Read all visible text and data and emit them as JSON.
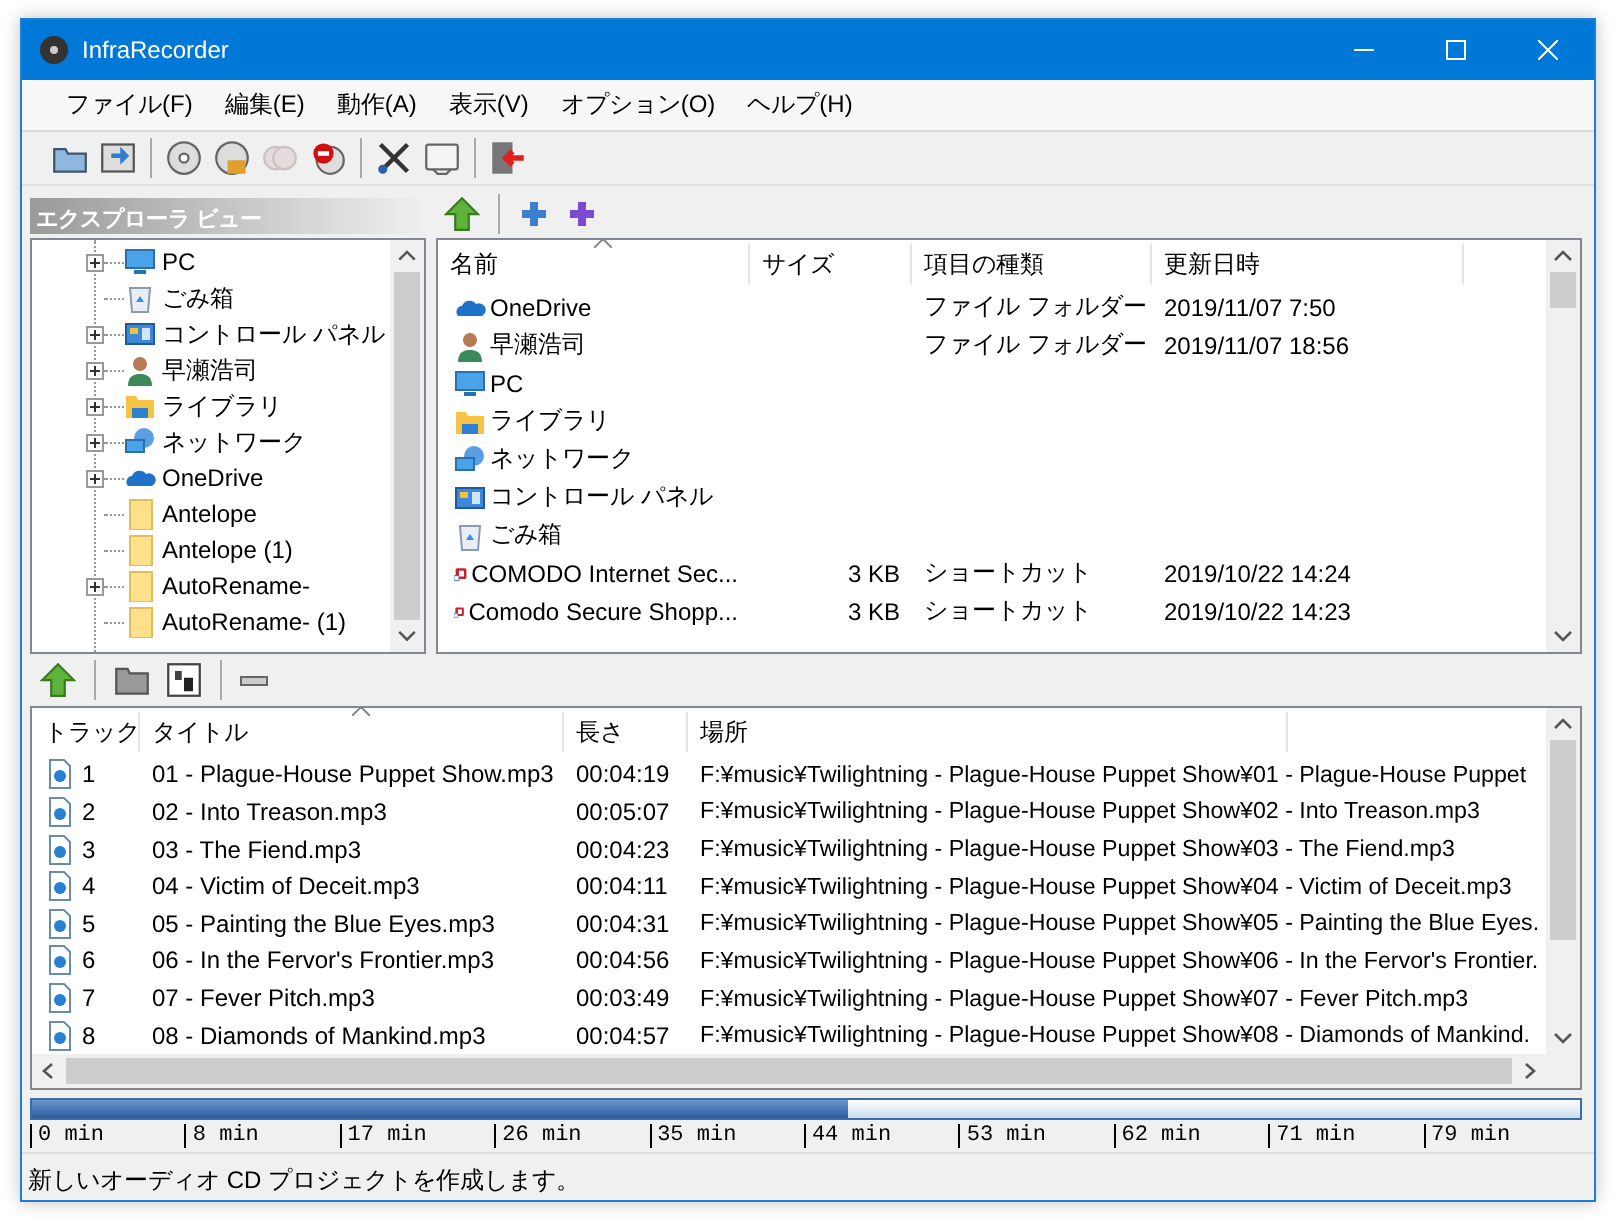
{
  "window": {
    "title": "InfraRecorder"
  },
  "menu": [
    "ファイル(F)",
    "編集(E)",
    "動作(A)",
    "表示(V)",
    "オプション(O)",
    "ヘルプ(H)"
  ],
  "toolbar": [
    {
      "kind": "open",
      "disabled": false
    },
    {
      "kind": "save",
      "disabled": false
    },
    {
      "kind": "sep"
    },
    {
      "kind": "disc",
      "disabled": false
    },
    {
      "kind": "discbox",
      "disabled": false
    },
    {
      "kind": "discs",
      "disabled": true
    },
    {
      "kind": "discstop",
      "disabled": false
    },
    {
      "kind": "sep"
    },
    {
      "kind": "scissors",
      "disabled": false
    },
    {
      "kind": "tray",
      "disabled": false
    },
    {
      "kind": "sep"
    },
    {
      "kind": "exit",
      "disabled": false
    }
  ],
  "explorer": {
    "title": "エクスプローラ ビュー",
    "tree": [
      {
        "label": "PC",
        "kind": "pc",
        "expandable": true
      },
      {
        "label": "ごみ箱",
        "kind": "recycle",
        "expandable": false
      },
      {
        "label": "コントロール パネル",
        "kind": "control",
        "expandable": true
      },
      {
        "label": "早瀬浩司",
        "kind": "user",
        "expandable": true
      },
      {
        "label": "ライブラリ",
        "kind": "library",
        "expandable": true
      },
      {
        "label": "ネットワーク",
        "kind": "network",
        "expandable": true
      },
      {
        "label": "OneDrive",
        "kind": "onedrive",
        "expandable": true
      },
      {
        "label": "Antelope",
        "kind": "folder",
        "expandable": false
      },
      {
        "label": "Antelope (1)",
        "kind": "folder",
        "expandable": false
      },
      {
        "label": "AutoRename-",
        "kind": "folder",
        "expandable": true
      },
      {
        "label": "AutoRename- (1)",
        "kind": "folder",
        "expandable": false
      }
    ],
    "files": {
      "columns": [
        "名前",
        "サイズ",
        "項目の種類",
        "更新日時"
      ],
      "rows": [
        {
          "name": "OneDrive",
          "kind": "onedrive",
          "size": "",
          "type": "ファイル フォルダー",
          "date": "2019/11/07 7:50"
        },
        {
          "name": "早瀬浩司",
          "kind": "user",
          "size": "",
          "type": "ファイル フォルダー",
          "date": "2019/11/07 18:56"
        },
        {
          "name": "PC",
          "kind": "pc",
          "size": "",
          "type": "",
          "date": ""
        },
        {
          "name": "ライブラリ",
          "kind": "library",
          "size": "",
          "type": "",
          "date": ""
        },
        {
          "name": "ネットワーク",
          "kind": "network",
          "size": "",
          "type": "",
          "date": ""
        },
        {
          "name": "コントロール パネル",
          "kind": "control",
          "size": "",
          "type": "",
          "date": ""
        },
        {
          "name": "ごみ箱",
          "kind": "recycle",
          "size": "",
          "type": "",
          "date": ""
        },
        {
          "name": "COMODO Internet Sec...",
          "kind": "shortcut",
          "size": "3 KB",
          "type": "ショートカット",
          "date": "2019/10/22 14:24"
        },
        {
          "name": "Comodo Secure Shopp...",
          "kind": "shortcut",
          "size": "3 KB",
          "type": "ショートカット",
          "date": "2019/10/22 14:23"
        }
      ]
    }
  },
  "tracks": {
    "columns": [
      "トラック",
      "タイトル",
      "長さ",
      "場所"
    ],
    "rows": [
      {
        "track": "1",
        "title": "01 - Plague-House Puppet Show.mp3",
        "length": "00:04:19",
        "location": "F:¥music¥Twilightning - Plague-House Puppet Show¥01 - Plague-House Puppet"
      },
      {
        "track": "2",
        "title": "02 - Into Treason.mp3",
        "length": "00:05:07",
        "location": "F:¥music¥Twilightning - Plague-House Puppet Show¥02 - Into Treason.mp3"
      },
      {
        "track": "3",
        "title": "03 - The Fiend.mp3",
        "length": "00:04:23",
        "location": "F:¥music¥Twilightning - Plague-House Puppet Show¥03 - The Fiend.mp3"
      },
      {
        "track": "4",
        "title": "04 - Victim of Deceit.mp3",
        "length": "00:04:11",
        "location": "F:¥music¥Twilightning - Plague-House Puppet Show¥04 - Victim of Deceit.mp3"
      },
      {
        "track": "5",
        "title": "05 - Painting the Blue Eyes.mp3",
        "length": "00:04:31",
        "location": "F:¥music¥Twilightning - Plague-House Puppet Show¥05 - Painting the Blue Eyes."
      },
      {
        "track": "6",
        "title": "06 - In the Fervor's Frontier.mp3",
        "length": "00:04:56",
        "location": "F:¥music¥Twilightning - Plague-House Puppet Show¥06 - In the Fervor's Frontier."
      },
      {
        "track": "7",
        "title": "07 - Fever Pitch.mp3",
        "length": "00:03:49",
        "location": "F:¥music¥Twilightning - Plague-House Puppet Show¥07 - Fever Pitch.mp3"
      },
      {
        "track": "8",
        "title": "08 - Diamonds of Mankind.mp3",
        "length": "00:04:57",
        "location": "F:¥music¥Twilightning - Plague-House Puppet Show¥08 - Diamonds of Mankind."
      }
    ]
  },
  "disc_usage": {
    "level": 0.527,
    "ticks": [
      "0 min",
      "8 min",
      "17 min",
      "26 min",
      "35 min",
      "44 min",
      "53 min",
      "62 min",
      "71 min",
      "79 min"
    ]
  },
  "status_bar": "新しいオーディオ CD プロジェクトを作成します。"
}
